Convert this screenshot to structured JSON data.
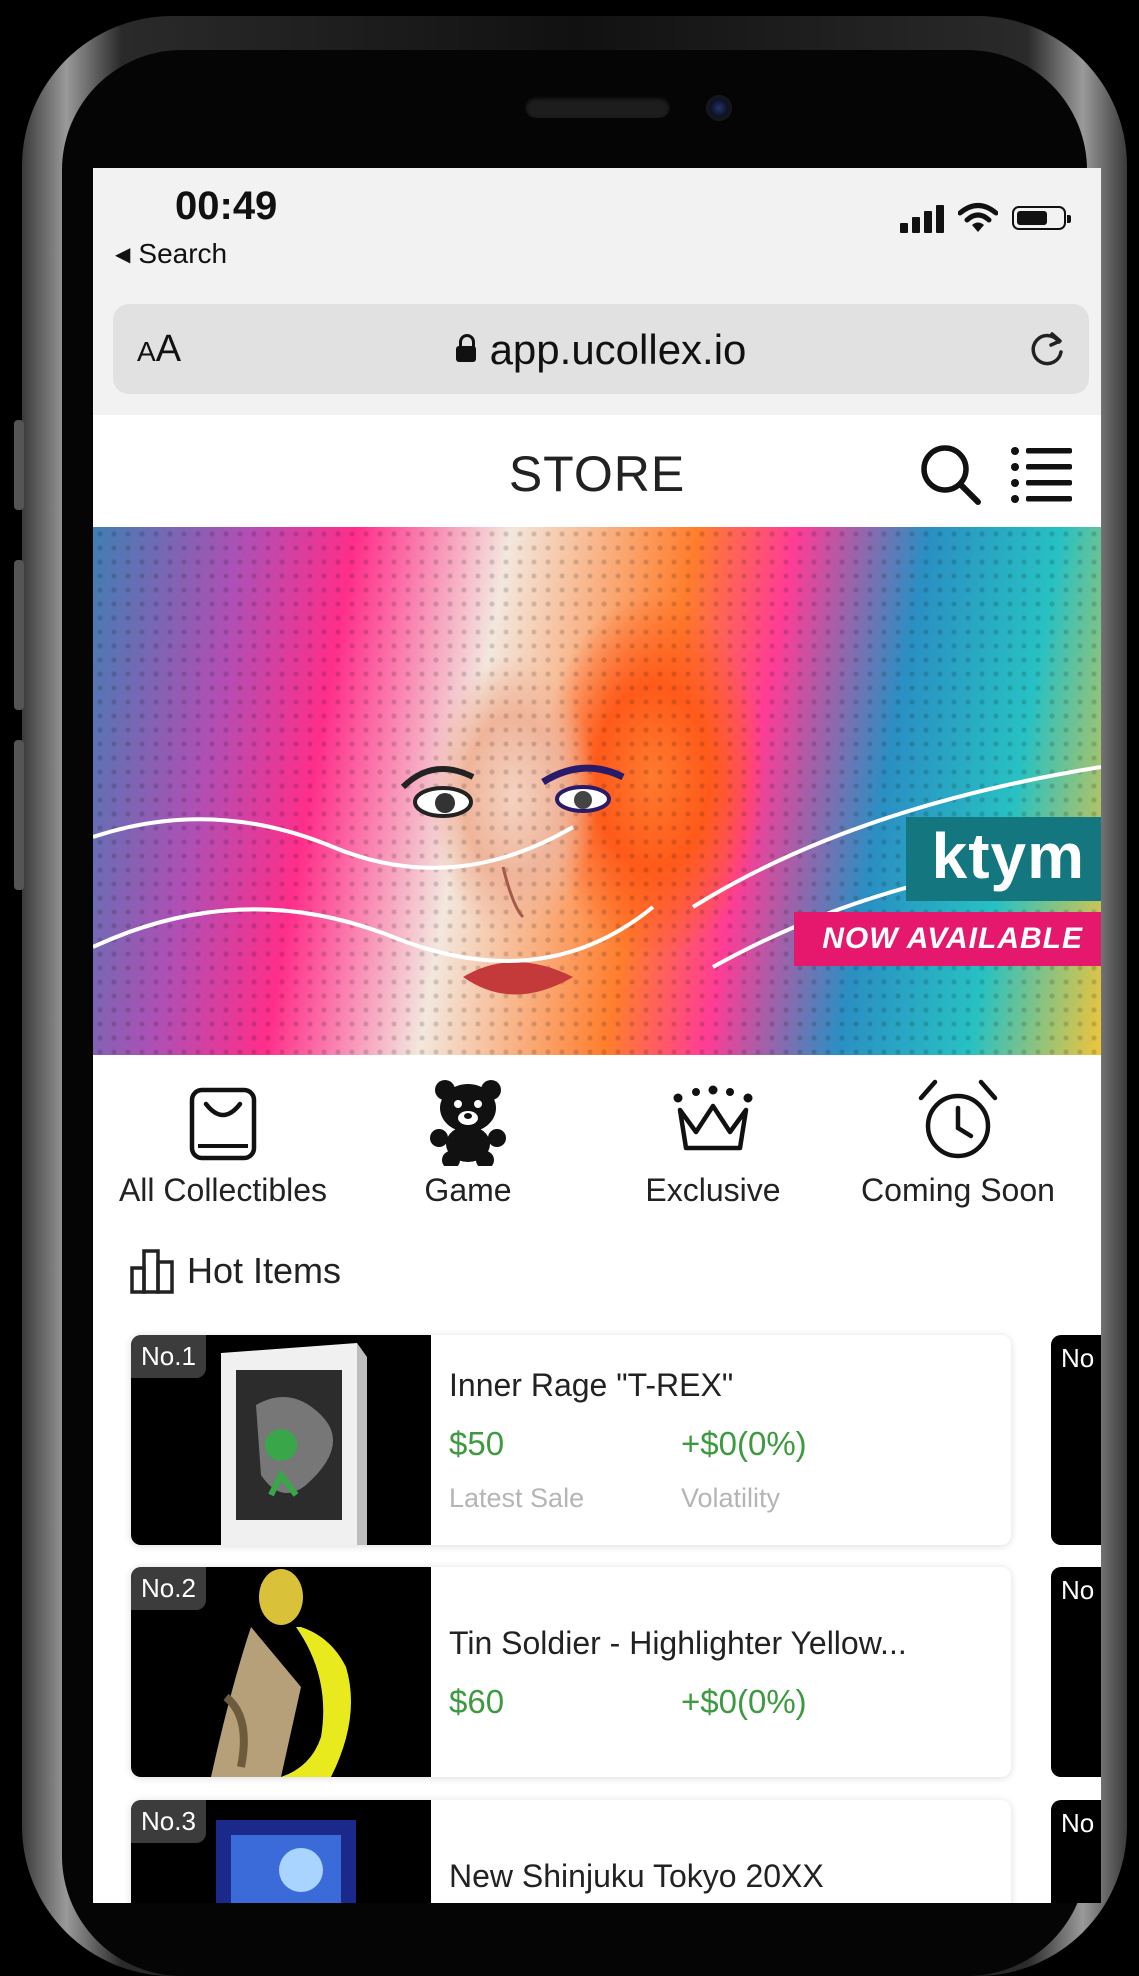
{
  "status_bar": {
    "time": "00:49",
    "back_label": "Search",
    "back_icon": "back-triangle-icon",
    "icons": [
      "cellular-signal-icon",
      "wifi-icon",
      "battery-icon"
    ]
  },
  "browser": {
    "text_size_label_big": "A",
    "text_size_label_small": "A",
    "url": "app.ucollex.io",
    "lock_icon": "lock-icon",
    "reload_icon": "reload-icon"
  },
  "header": {
    "title": "STORE",
    "icons": [
      "search-icon",
      "menu-icon"
    ]
  },
  "banner": {
    "title": "ktym",
    "tagline": "NOW AVAILABLE"
  },
  "categories": [
    {
      "label": "All Collectibles",
      "icon": "shopping-bag-icon"
    },
    {
      "label": "Game",
      "icon": "teddy-bear-icon"
    },
    {
      "label": "Exclusive",
      "icon": "crown-icon"
    },
    {
      "label": "Coming Soon",
      "icon": "alarm-clock-icon"
    }
  ],
  "hot_items": {
    "title": "Hot Items",
    "icon": "bar-chart-icon",
    "items": [
      {
        "rank": "No.1",
        "name": "Inner Rage \"T-REX\"",
        "price": "$50",
        "volatility": "+$0(0%)",
        "price_label": "Latest Sale",
        "volatility_label": "Volatility"
      },
      {
        "rank": "No.2",
        "name": "Tin Soldier - Highlighter Yellow...",
        "price": "$60",
        "volatility": "+$0(0%)"
      },
      {
        "rank": "No.3",
        "name": "New Shinjuku Tokyo 20XX"
      }
    ],
    "peek_ranks": [
      "No",
      "No",
      "No"
    ]
  },
  "colors": {
    "price_green": "#3e9a40",
    "banner_teal": "#14767e",
    "banner_pink": "#e6186e"
  }
}
